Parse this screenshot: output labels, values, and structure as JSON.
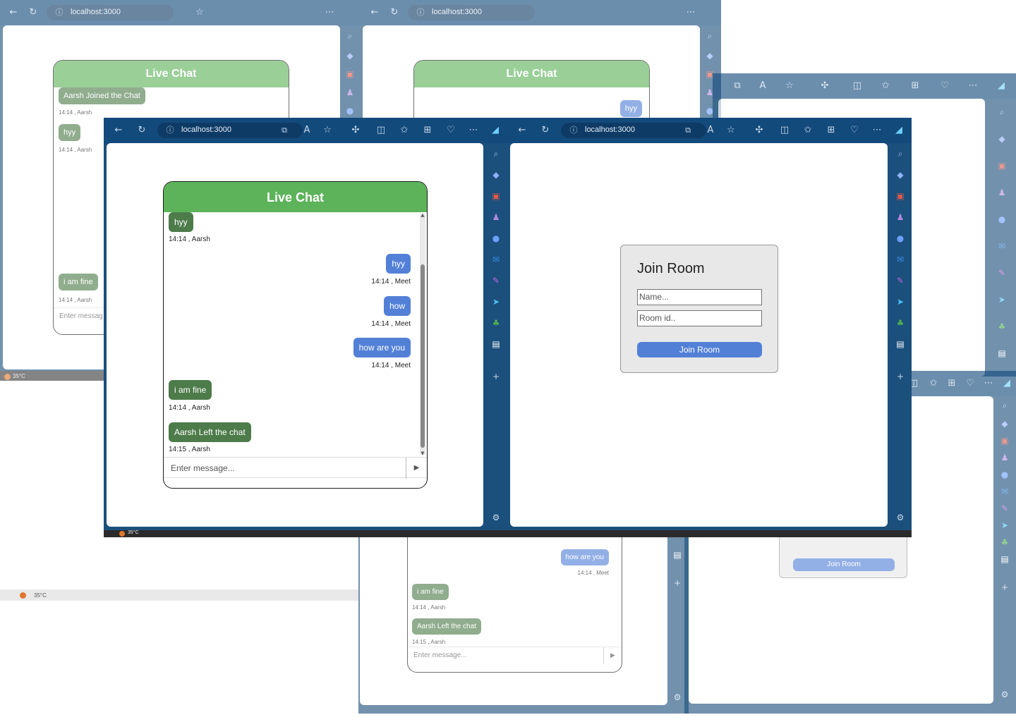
{
  "browser": {
    "url": "localhost:3000",
    "icons": [
      "back-arrow",
      "refresh",
      "info",
      "open-app",
      "read-aloud",
      "favorite-star",
      "extensions",
      "split-screen",
      "favorites",
      "collections",
      "browser-essentials",
      "more",
      "copilot"
    ],
    "sidebar_icons": [
      "search",
      "shopping-tag",
      "tools",
      "games",
      "bing-chat",
      "outlook",
      "designer",
      "telegram",
      "tree",
      "office",
      "add",
      "settings"
    ]
  },
  "chat": {
    "title": "Live Chat",
    "messages": [
      {
        "text": "hyy",
        "meta": "14:14 , Aarsh",
        "side": "left"
      },
      {
        "text": "hyy",
        "meta": "14:14 , Meet",
        "side": "right"
      },
      {
        "text": "how",
        "meta": "14:14 , Meet",
        "side": "right"
      },
      {
        "text": "how are you",
        "meta": "14:14 , Meet",
        "side": "right"
      },
      {
        "text": "i am fine",
        "meta": "14:14 , Aarsh",
        "side": "left"
      },
      {
        "text": "Aarsh Left the chat",
        "meta": "14:15 , Aarsh",
        "side": "left"
      }
    ],
    "input_placeholder": "Enter message...",
    "send_icon": "play-triangle"
  },
  "background_chat": {
    "joined_text": "Aarsh Joined the Chat",
    "joined_meta": "14:14 , Aarsh",
    "hyy_meta": "14:14 , Aarsh",
    "fine_meta": "14:14 , Aarsh",
    "input_placeholder": "Enter messag"
  },
  "join_room": {
    "title": "Join Room",
    "name_placeholder": "Name...",
    "room_placeholder": "Room id..",
    "button_label": "Join Room"
  },
  "taskbar": {
    "weather": "35°C"
  },
  "colors": {
    "header_green": "#5db35a",
    "left_bubble": "#4d7c4a",
    "right_bubble": "#5280d7",
    "browser_chrome": "#134a7c",
    "button_blue": "#5280d7"
  }
}
